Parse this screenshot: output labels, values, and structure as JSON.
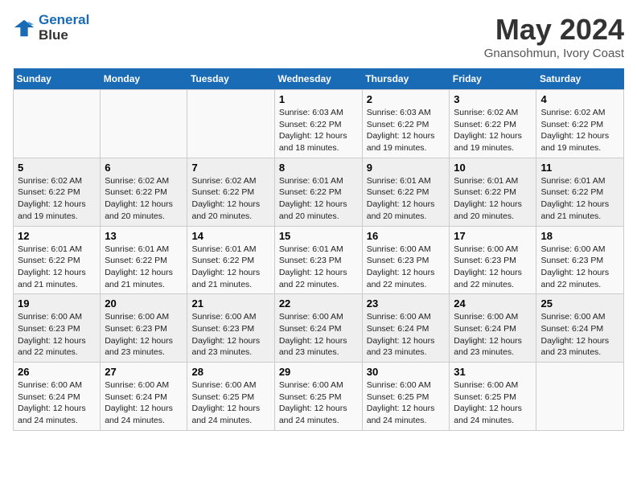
{
  "logo": {
    "line1": "General",
    "line2": "Blue"
  },
  "title": "May 2024",
  "location": "Gnansohmun, Ivory Coast",
  "days_of_week": [
    "Sunday",
    "Monday",
    "Tuesday",
    "Wednesday",
    "Thursday",
    "Friday",
    "Saturday"
  ],
  "weeks": [
    [
      {
        "day": "",
        "info": ""
      },
      {
        "day": "",
        "info": ""
      },
      {
        "day": "",
        "info": ""
      },
      {
        "day": "1",
        "info": "Sunrise: 6:03 AM\nSunset: 6:22 PM\nDaylight: 12 hours and 18 minutes."
      },
      {
        "day": "2",
        "info": "Sunrise: 6:03 AM\nSunset: 6:22 PM\nDaylight: 12 hours and 19 minutes."
      },
      {
        "day": "3",
        "info": "Sunrise: 6:02 AM\nSunset: 6:22 PM\nDaylight: 12 hours and 19 minutes."
      },
      {
        "day": "4",
        "info": "Sunrise: 6:02 AM\nSunset: 6:22 PM\nDaylight: 12 hours and 19 minutes."
      }
    ],
    [
      {
        "day": "5",
        "info": "Sunrise: 6:02 AM\nSunset: 6:22 PM\nDaylight: 12 hours and 19 minutes."
      },
      {
        "day": "6",
        "info": "Sunrise: 6:02 AM\nSunset: 6:22 PM\nDaylight: 12 hours and 20 minutes."
      },
      {
        "day": "7",
        "info": "Sunrise: 6:02 AM\nSunset: 6:22 PM\nDaylight: 12 hours and 20 minutes."
      },
      {
        "day": "8",
        "info": "Sunrise: 6:01 AM\nSunset: 6:22 PM\nDaylight: 12 hours and 20 minutes."
      },
      {
        "day": "9",
        "info": "Sunrise: 6:01 AM\nSunset: 6:22 PM\nDaylight: 12 hours and 20 minutes."
      },
      {
        "day": "10",
        "info": "Sunrise: 6:01 AM\nSunset: 6:22 PM\nDaylight: 12 hours and 20 minutes."
      },
      {
        "day": "11",
        "info": "Sunrise: 6:01 AM\nSunset: 6:22 PM\nDaylight: 12 hours and 21 minutes."
      }
    ],
    [
      {
        "day": "12",
        "info": "Sunrise: 6:01 AM\nSunset: 6:22 PM\nDaylight: 12 hours and 21 minutes."
      },
      {
        "day": "13",
        "info": "Sunrise: 6:01 AM\nSunset: 6:22 PM\nDaylight: 12 hours and 21 minutes."
      },
      {
        "day": "14",
        "info": "Sunrise: 6:01 AM\nSunset: 6:22 PM\nDaylight: 12 hours and 21 minutes."
      },
      {
        "day": "15",
        "info": "Sunrise: 6:01 AM\nSunset: 6:23 PM\nDaylight: 12 hours and 22 minutes."
      },
      {
        "day": "16",
        "info": "Sunrise: 6:00 AM\nSunset: 6:23 PM\nDaylight: 12 hours and 22 minutes."
      },
      {
        "day": "17",
        "info": "Sunrise: 6:00 AM\nSunset: 6:23 PM\nDaylight: 12 hours and 22 minutes."
      },
      {
        "day": "18",
        "info": "Sunrise: 6:00 AM\nSunset: 6:23 PM\nDaylight: 12 hours and 22 minutes."
      }
    ],
    [
      {
        "day": "19",
        "info": "Sunrise: 6:00 AM\nSunset: 6:23 PM\nDaylight: 12 hours and 22 minutes."
      },
      {
        "day": "20",
        "info": "Sunrise: 6:00 AM\nSunset: 6:23 PM\nDaylight: 12 hours and 23 minutes."
      },
      {
        "day": "21",
        "info": "Sunrise: 6:00 AM\nSunset: 6:23 PM\nDaylight: 12 hours and 23 minutes."
      },
      {
        "day": "22",
        "info": "Sunrise: 6:00 AM\nSunset: 6:24 PM\nDaylight: 12 hours and 23 minutes."
      },
      {
        "day": "23",
        "info": "Sunrise: 6:00 AM\nSunset: 6:24 PM\nDaylight: 12 hours and 23 minutes."
      },
      {
        "day": "24",
        "info": "Sunrise: 6:00 AM\nSunset: 6:24 PM\nDaylight: 12 hours and 23 minutes."
      },
      {
        "day": "25",
        "info": "Sunrise: 6:00 AM\nSunset: 6:24 PM\nDaylight: 12 hours and 23 minutes."
      }
    ],
    [
      {
        "day": "26",
        "info": "Sunrise: 6:00 AM\nSunset: 6:24 PM\nDaylight: 12 hours and 24 minutes."
      },
      {
        "day": "27",
        "info": "Sunrise: 6:00 AM\nSunset: 6:24 PM\nDaylight: 12 hours and 24 minutes."
      },
      {
        "day": "28",
        "info": "Sunrise: 6:00 AM\nSunset: 6:25 PM\nDaylight: 12 hours and 24 minutes."
      },
      {
        "day": "29",
        "info": "Sunrise: 6:00 AM\nSunset: 6:25 PM\nDaylight: 12 hours and 24 minutes."
      },
      {
        "day": "30",
        "info": "Sunrise: 6:00 AM\nSunset: 6:25 PM\nDaylight: 12 hours and 24 minutes."
      },
      {
        "day": "31",
        "info": "Sunrise: 6:00 AM\nSunset: 6:25 PM\nDaylight: 12 hours and 24 minutes."
      },
      {
        "day": "",
        "info": ""
      }
    ]
  ]
}
